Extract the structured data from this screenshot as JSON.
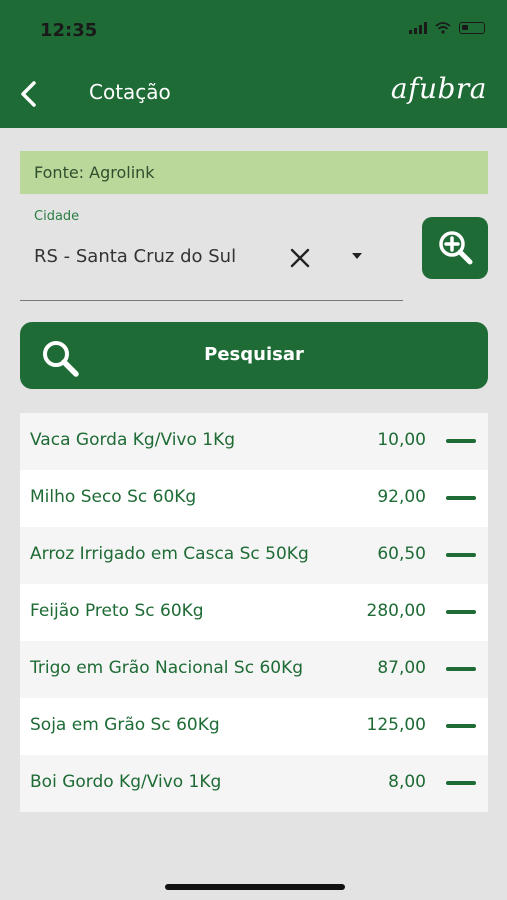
{
  "status_bar": {
    "time": "12:35"
  },
  "header": {
    "title": "Cotação",
    "logo_text": "afubra"
  },
  "source": {
    "text": "Fonte: Agrolink"
  },
  "city": {
    "label": "Cidade",
    "value": "RS - Santa Cruz do Sul"
  },
  "search": {
    "label": "Pesquisar"
  },
  "quotes": [
    {
      "name": "Vaca Gorda Kg/Vivo 1Kg",
      "price": "10,00"
    },
    {
      "name": "Milho Seco Sc 60Kg",
      "price": "92,00"
    },
    {
      "name": "Arroz Irrigado em Casca Sc 50Kg",
      "price": "60,50"
    },
    {
      "name": "Feijão Preto Sc 60Kg",
      "price": "280,00"
    },
    {
      "name": "Trigo em Grão Nacional Sc 60Kg",
      "price": "87,00"
    },
    {
      "name": "Soja em Grão Sc 60Kg",
      "price": "125,00"
    },
    {
      "name": "Boi Gordo Kg/Vivo 1Kg",
      "price": "8,00"
    }
  ],
  "colors": {
    "primary": "#1e6b35",
    "source_bg": "#b9d89a",
    "background": "#e3e3e3"
  },
  "icons": {
    "back": "chevron-left-icon",
    "clear": "close-icon",
    "zoom": "zoom-in-icon",
    "search": "search-icon",
    "trend": "neutral-dash-icon"
  }
}
